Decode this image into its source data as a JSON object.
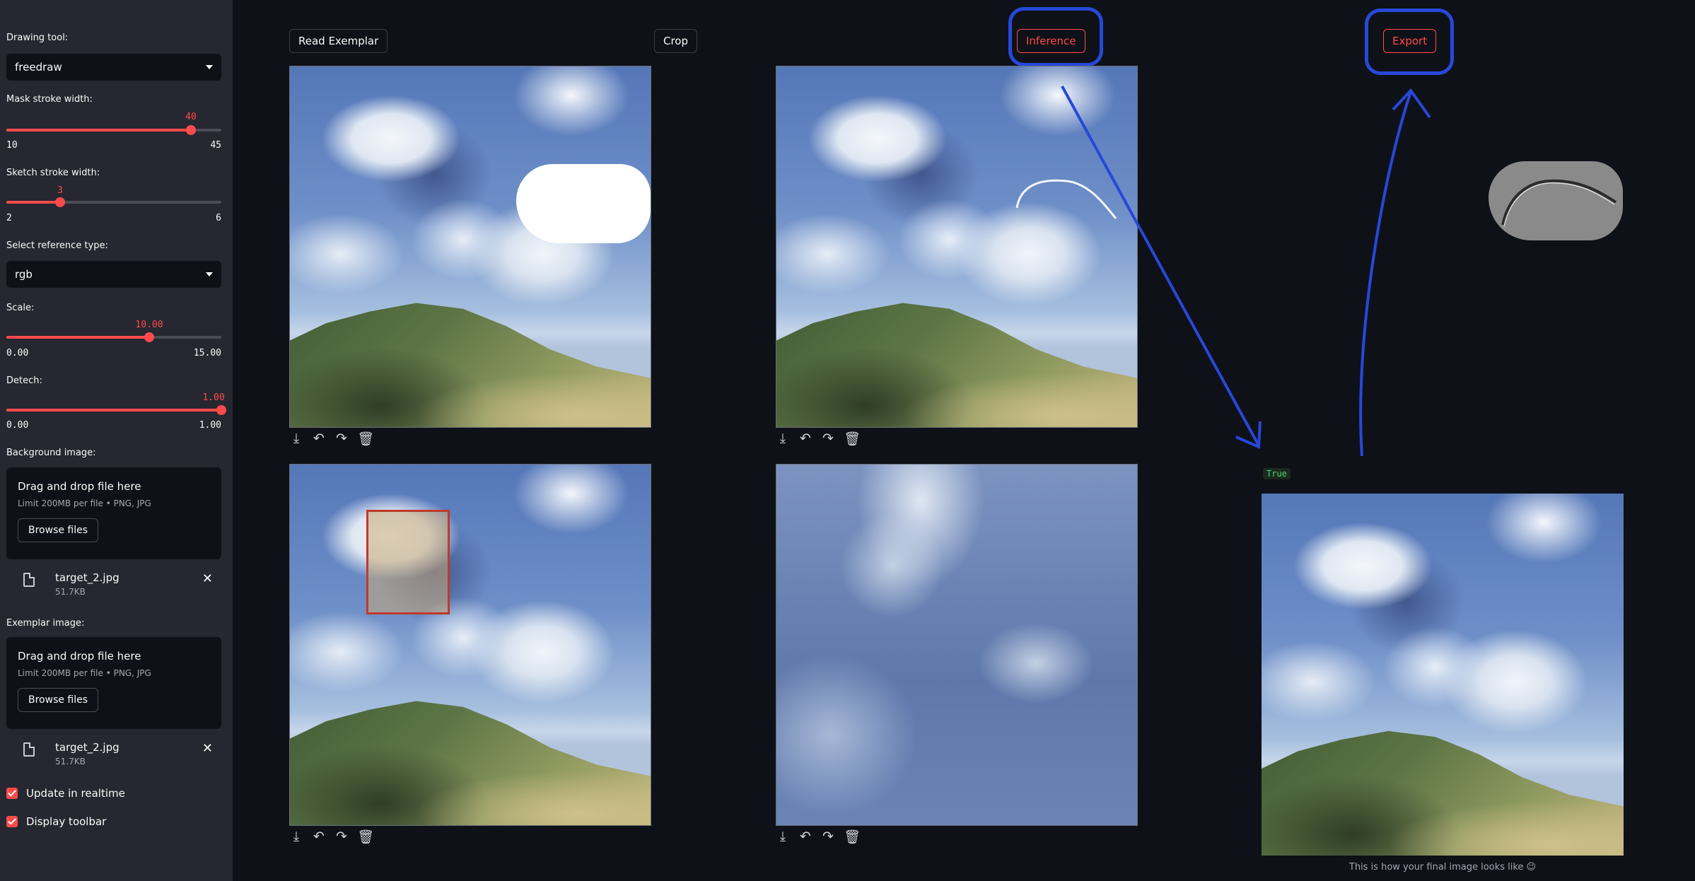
{
  "sidebar": {
    "drawing_tool": {
      "label": "Drawing tool:",
      "value": "freedraw"
    },
    "mask_stroke": {
      "label": "Mask stroke width:",
      "value": "40",
      "min": "10",
      "max": "45",
      "fraction": 0.857
    },
    "sketch_stroke": {
      "label": "Sketch stroke width:",
      "value": "3",
      "min": "2",
      "max": "6",
      "fraction": 0.25
    },
    "reference_type": {
      "label": "Select reference type:",
      "value": "rgb"
    },
    "scale": {
      "label": "Scale:",
      "value": "10.00",
      "min": "0.00",
      "max": "15.00",
      "fraction": 0.667
    },
    "detech": {
      "label": "Detech:",
      "value": "1.00",
      "min": "0.00",
      "max": "1.00",
      "fraction": 1.0
    },
    "background_image": {
      "label": "Background image:",
      "drop_title": "Drag and drop file here",
      "limit": "Limit 200MB per file • PNG, JPG",
      "browse": "Browse files",
      "file_name": "target_2.jpg",
      "file_size": "51.7KB"
    },
    "exemplar_image": {
      "label": "Exemplar image:",
      "drop_title": "Drag and drop file here",
      "limit": "Limit 200MB per file • PNG, JPG",
      "browse": "Browse files",
      "file_name": "target_2.jpg",
      "file_size": "51.7KB"
    },
    "update_realtime": {
      "label": "Update in realtime",
      "checked": true
    },
    "display_toolbar": {
      "label": "Display toolbar",
      "checked": true
    }
  },
  "main": {
    "read_exemplar": "Read Exemplar",
    "crop": "Crop",
    "inference": "Inference",
    "export": "Export",
    "result_flag": "True",
    "caption": "This is how your final image looks like 😉",
    "accent_color": "#ff4b4b",
    "highlight_color": "#2748d9"
  },
  "icons": [
    "download-icon",
    "undo-icon",
    "redo-icon",
    "trash-icon",
    "file-icon",
    "close-icon",
    "chevron-down-icon"
  ]
}
